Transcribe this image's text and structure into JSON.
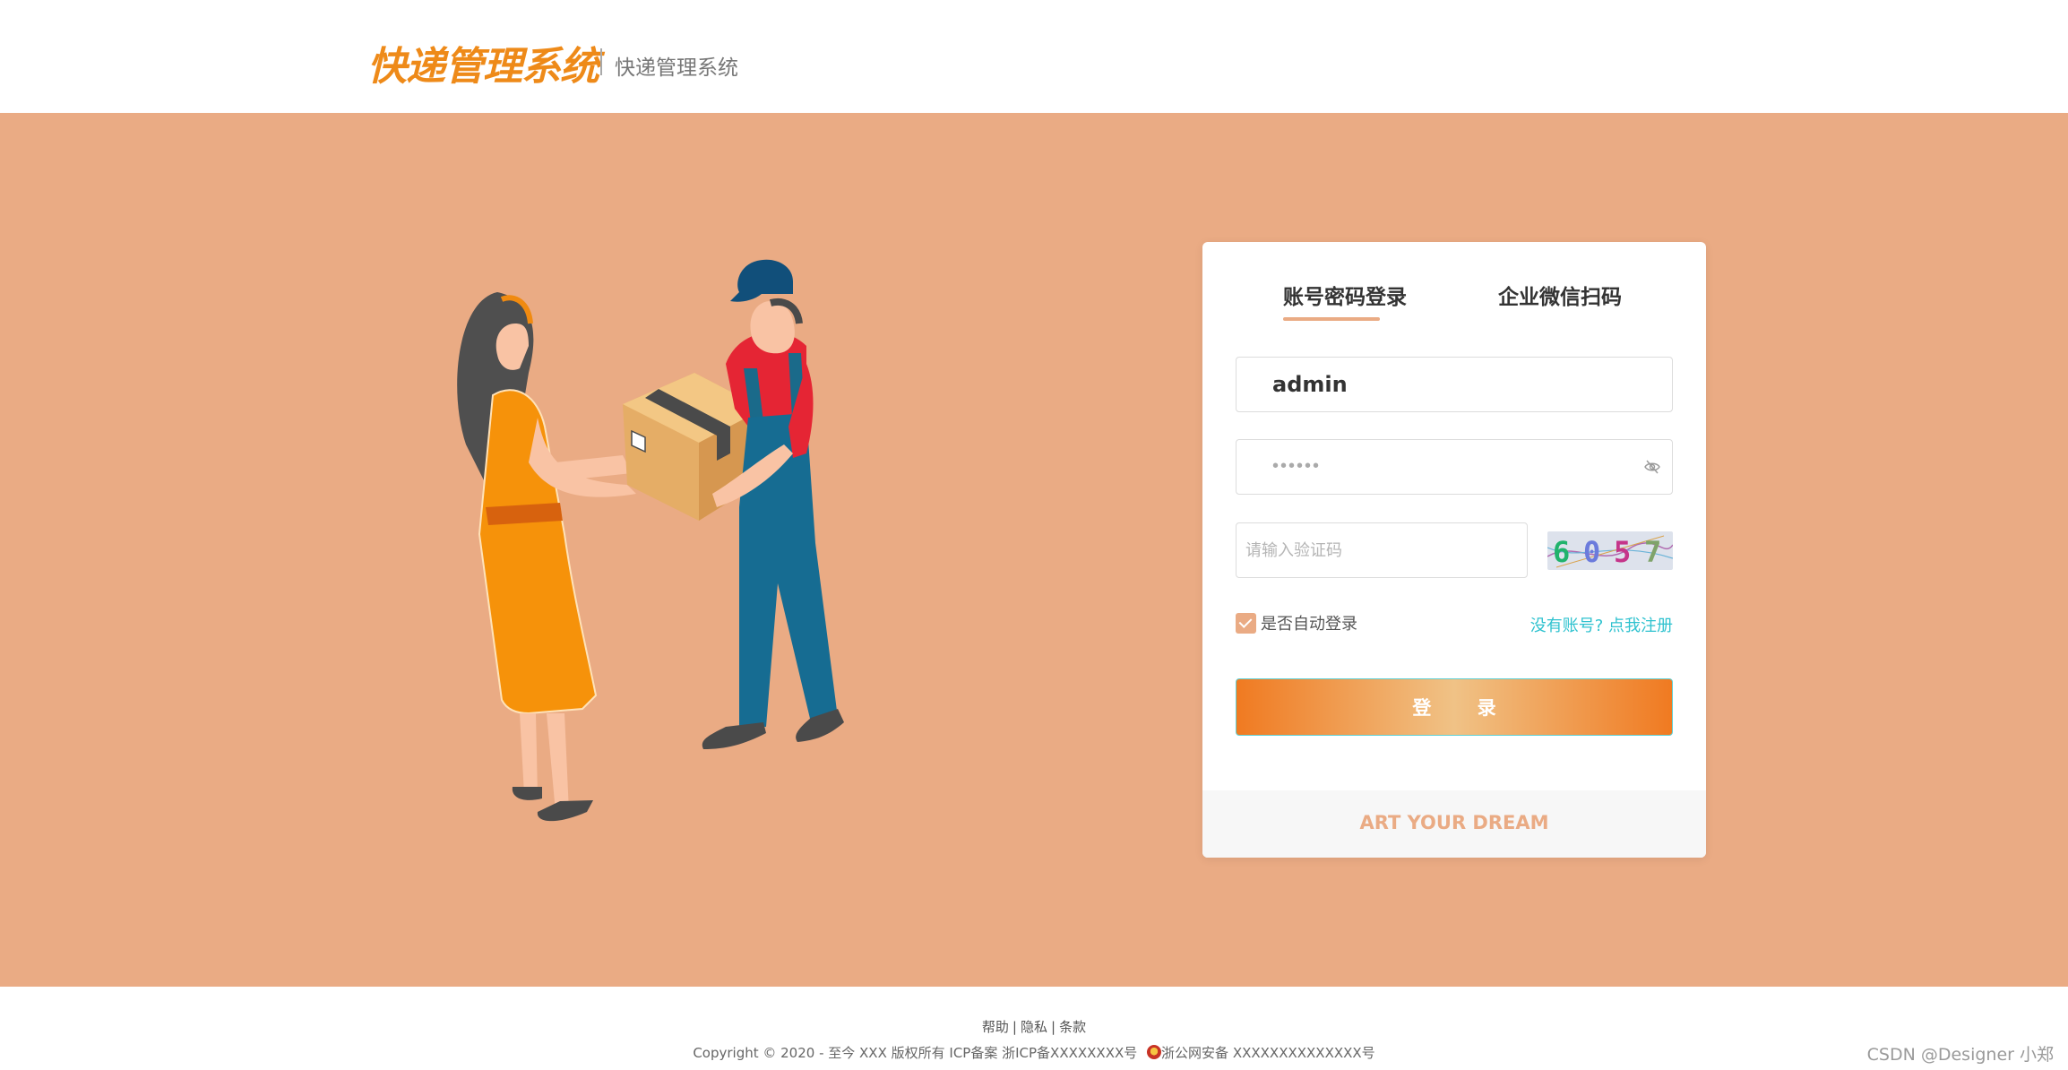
{
  "header": {
    "logo_text": "快递管理系统",
    "subtitle": "快递管理系统"
  },
  "login": {
    "tabs": [
      {
        "label": "账号密码登录",
        "active": true
      },
      {
        "label": "企业微信扫码",
        "active": false
      }
    ],
    "username_value": "admin",
    "password_masked": "••••••",
    "code_placeholder": "请输入验证码",
    "captcha_digits": [
      "6",
      "0",
      "5",
      "7"
    ],
    "remember_label": "是否自动登录",
    "remember_checked": true,
    "register_link": "没有账号? 点我注册",
    "submit_label": "登 录",
    "card_footer": "ART YOUR DREAM"
  },
  "footer": {
    "links": [
      "帮助",
      "隐私",
      "条款"
    ],
    "copyright_before_icon": "Copyright © 2020 - 至今 XXX 版权所有 ICP备案 浙ICP备XXXXXXXX号",
    "copyright_after_icon": "浙公网安备 XXXXXXXXXXXXXX号"
  },
  "watermark": "CSDN @Designer 小郑",
  "colors": {
    "banner": "#eaab84",
    "logo": "#ee8a19",
    "accent_link": "#2fc2cf",
    "button_gradient_edge": "#f07a21",
    "button_gradient_center": "#f0c286"
  },
  "icons": {
    "password_toggle": "eye-off-icon",
    "police_badge": "police-badge-icon"
  }
}
